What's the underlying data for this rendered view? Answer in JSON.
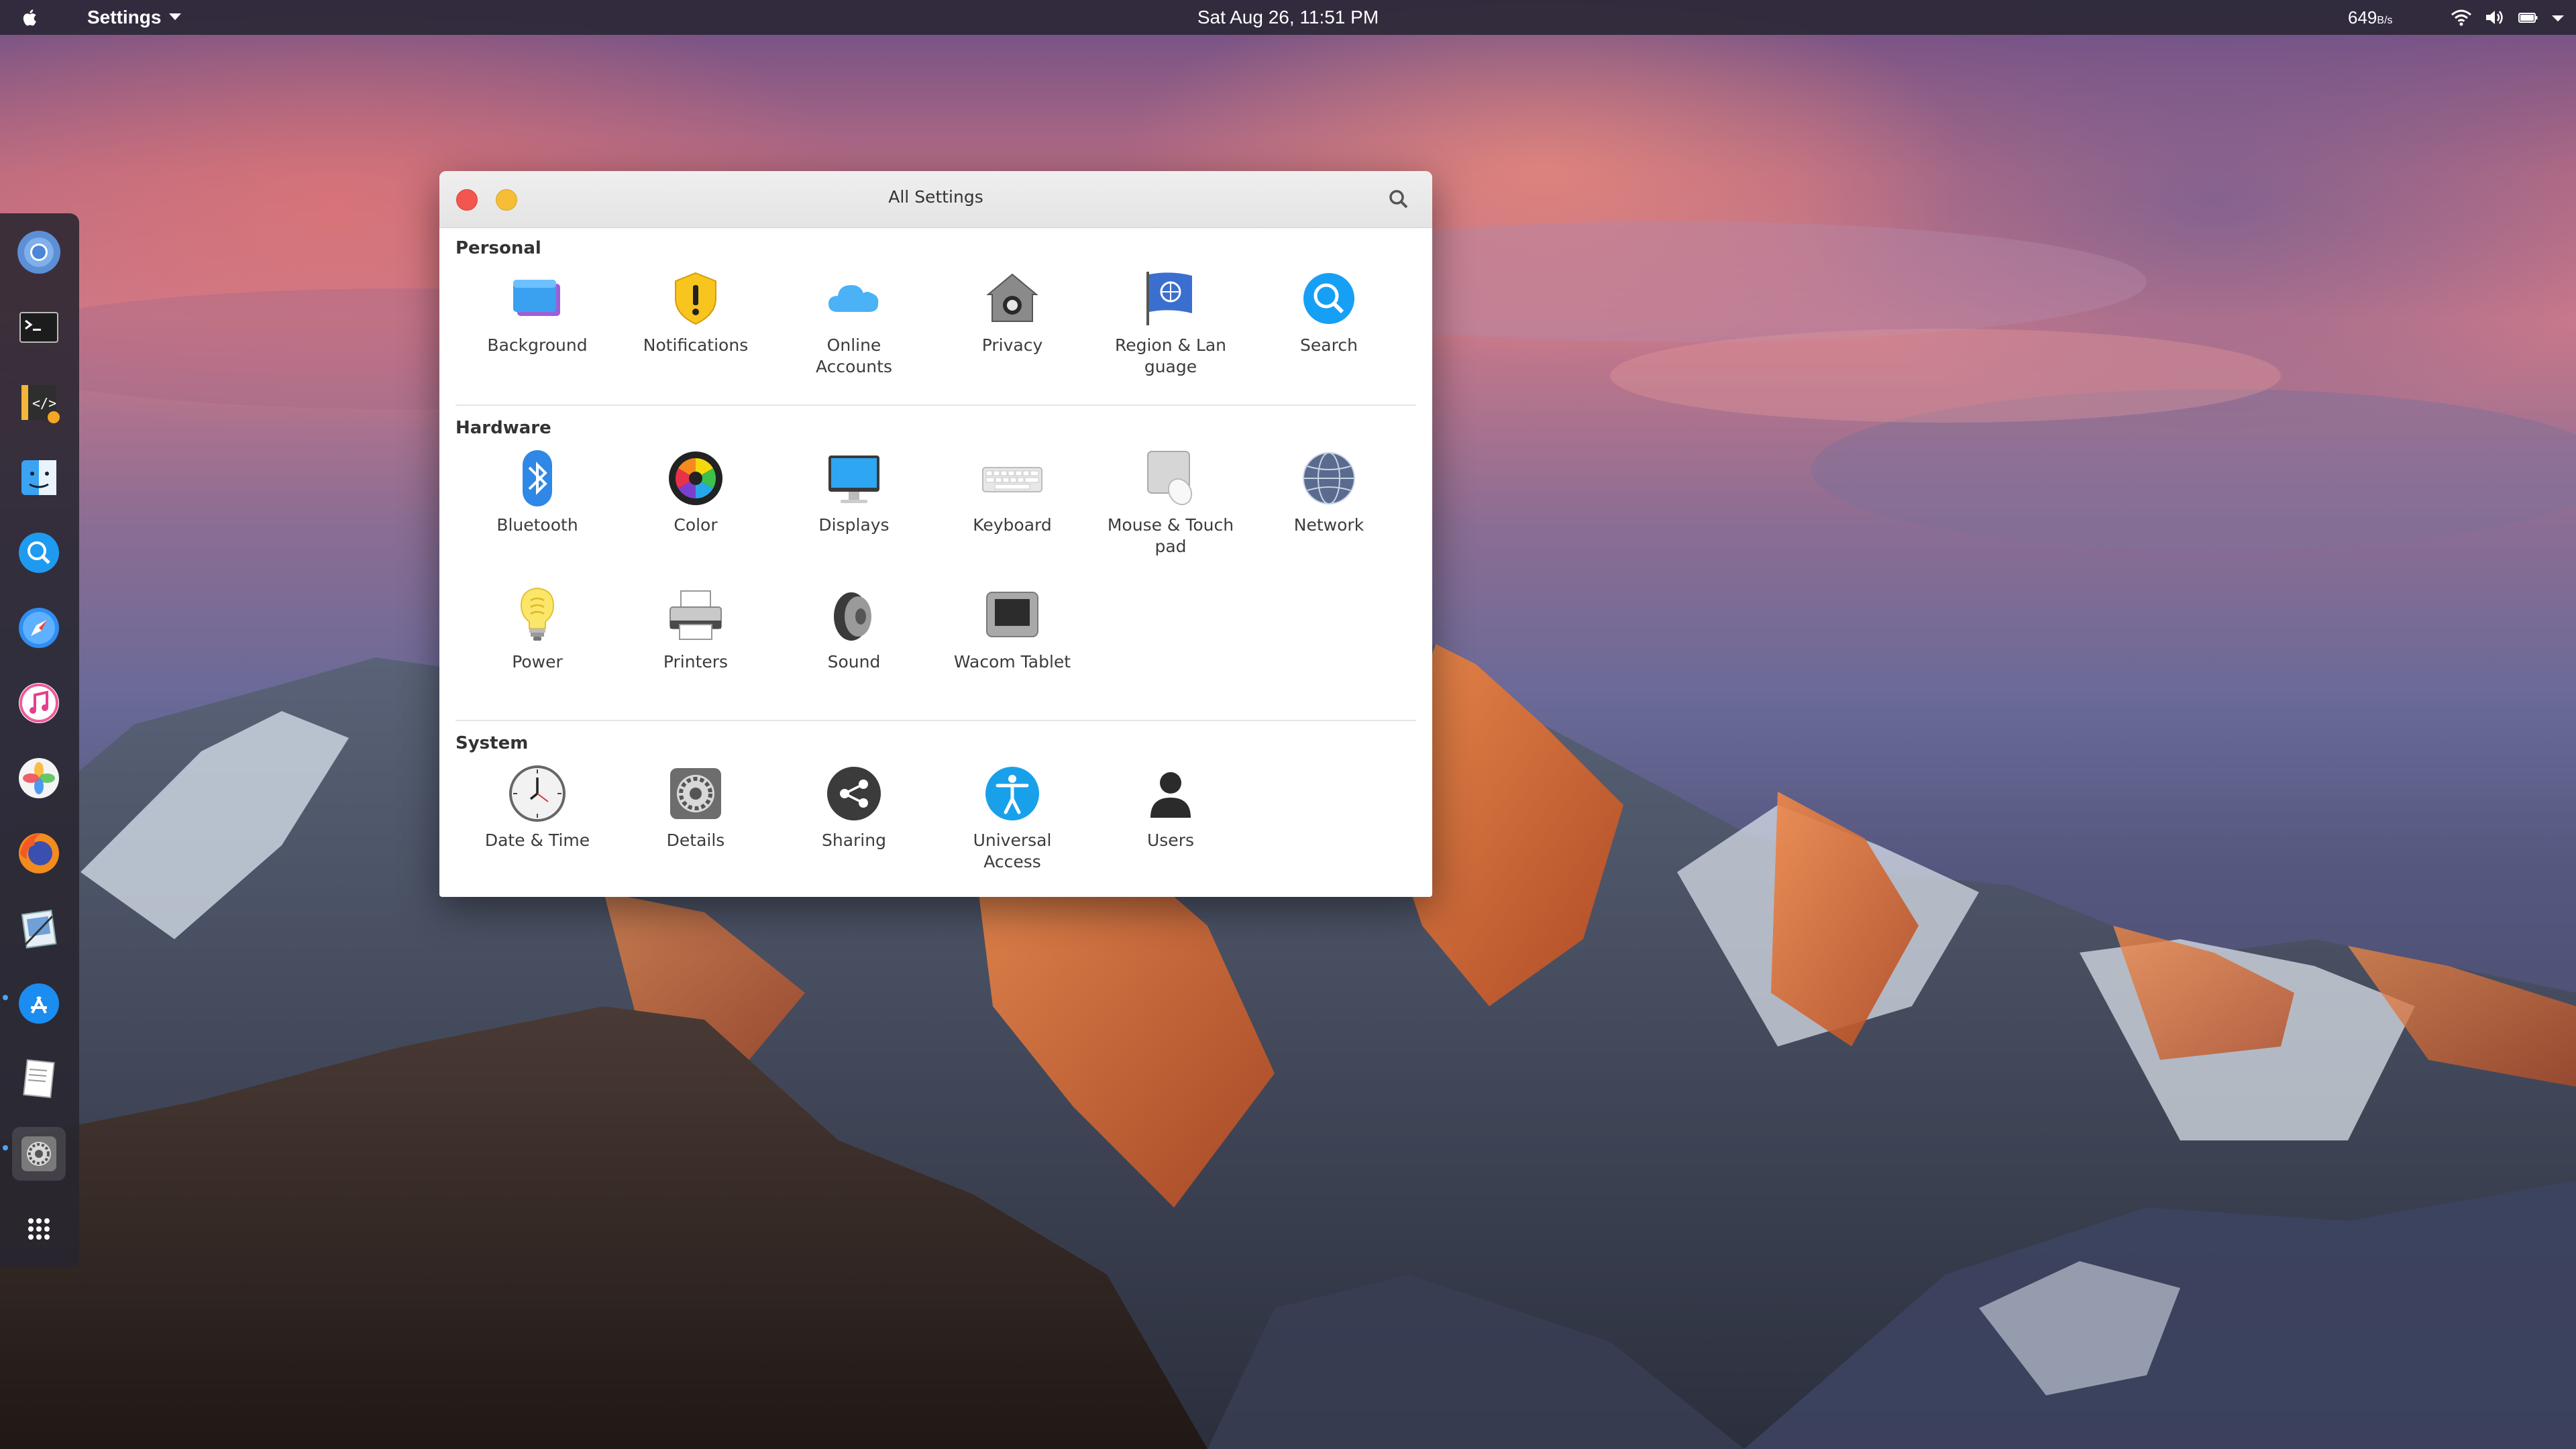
{
  "topbar": {
    "app_name": "Settings",
    "clock": "Sat Aug 26, 11:51 PM",
    "net_speed": "649",
    "net_unit": "B/s"
  },
  "dock": {
    "items": [
      "chromium",
      "terminal",
      "code-editor",
      "finder",
      "search",
      "safari",
      "music",
      "photos",
      "firefox",
      "preview",
      "app-store",
      "text-editor",
      "system-settings",
      "app-grid"
    ]
  },
  "window": {
    "title": "All Settings",
    "sections": {
      "personal": {
        "title": "Personal",
        "items": [
          "Background",
          "Notifications",
          "Online\nAccounts",
          "Privacy",
          "Region & Lan\nguage",
          "Search"
        ]
      },
      "hardware": {
        "title": "Hardware",
        "items": [
          "Bluetooth",
          "Color",
          "Displays",
          "Keyboard",
          "Mouse & Touch\npad",
          "Network",
          "Power",
          "Printers",
          "Sound",
          "Wacom Tablet"
        ]
      },
      "system": {
        "title": "System",
        "items": [
          "Date & Time",
          "Details",
          "Sharing",
          "Universal\nAccess",
          "Users"
        ]
      }
    }
  }
}
